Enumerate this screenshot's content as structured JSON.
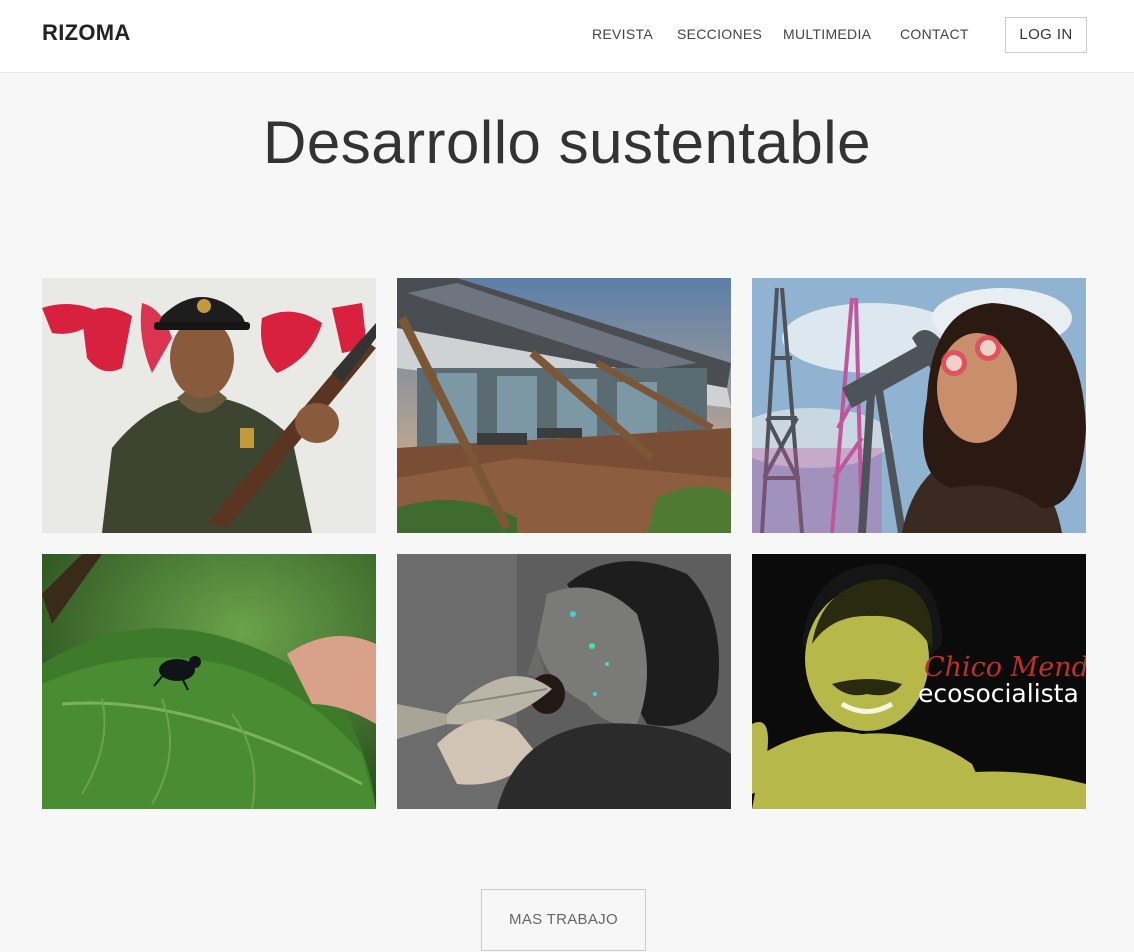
{
  "header": {
    "brand": "RIZOMA",
    "nav": [
      "REVISTA",
      "SECCIONES",
      "MULTIMEDIA",
      "CONTACT"
    ],
    "login_label": "LOG IN"
  },
  "page": {
    "title": "Desarrollo sustentable"
  },
  "gallery": {
    "items": [
      {
        "image": "armed-guard-photo"
      },
      {
        "image": "solar-house-photo"
      },
      {
        "image": "oil-pump-woman-photo"
      },
      {
        "image": "beetle-on-leaf-photo"
      },
      {
        "image": "man-eating-fish-photo"
      },
      {
        "image": "chico-mendes-poster",
        "overlay_script": "Chico Mendes",
        "overlay_text": "ecosocialista"
      }
    ]
  },
  "footer": {
    "more_label": "MAS TRABAJO"
  },
  "colors": {
    "background": "#f7f7f7",
    "header": "#ffffff",
    "text": "#333333",
    "poster_red": "#c0302a",
    "poster_green": "#b7b84a"
  }
}
